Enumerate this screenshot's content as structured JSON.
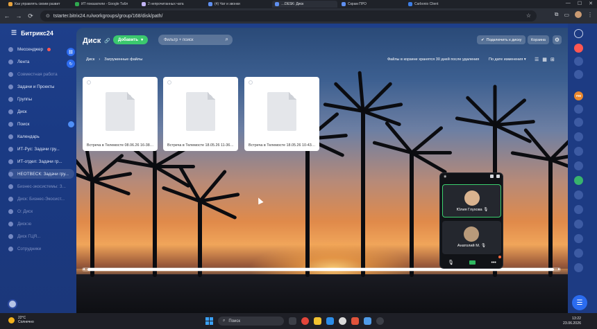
{
  "browser": {
    "tabs": [
      {
        "label": "Как управлять своим развит",
        "color": "#e8a33d"
      },
      {
        "label": "ИТ показатели - Google Табл",
        "color": "#2fa84f"
      },
      {
        "label": "2 непрочитанных чата",
        "color": "#c3b5f7"
      },
      {
        "label": "(4) Чат и звонки",
        "color": "#5f8ff0"
      },
      {
        "label": "…DESK: Диск",
        "color": "#5f8ff0",
        "active": true
      },
      {
        "label": "Скрам ПРО",
        "color": "#5f8ff0"
      },
      {
        "label": "Carbonio Client",
        "color": "#3d7ee6"
      }
    ],
    "url": "tstarter.bitrix24.ru/workgroups/group/168/disk/path/"
  },
  "leftmenu": {
    "brand": "Битрикс24",
    "items": [
      {
        "label": "Мессенджер",
        "state": "normal",
        "badge": "red"
      },
      {
        "label": "Лента",
        "state": "normal"
      },
      {
        "label": "Совместная работа",
        "state": "dim"
      },
      {
        "label": "Задачи и Проекты",
        "state": "normal"
      },
      {
        "label": "Группы",
        "state": "normal"
      },
      {
        "label": "Диск",
        "state": "normal"
      },
      {
        "label": "Поиск",
        "state": "normal",
        "badge": "blue"
      },
      {
        "label": "Календарь",
        "state": "normal"
      },
      {
        "label": "ИТ-Рус: Задачи гру...",
        "state": "normal"
      },
      {
        "label": "ИТ-отдел: Задачи гр...",
        "state": "normal"
      },
      {
        "label": "НЕОТВЕСК: Задачи гру...",
        "state": "active"
      },
      {
        "label": "Бизнес-экосистемы: З...",
        "state": "dim"
      },
      {
        "label": "Диск: Бизнес-Экосист...",
        "state": "dim"
      },
      {
        "label": "О: Диск",
        "state": "dim"
      },
      {
        "label": "Диск:ю",
        "state": "dim"
      },
      {
        "label": "Диск ГЦЯ...",
        "state": "dim"
      },
      {
        "label": "Сотрудники",
        "state": "dim"
      }
    ]
  },
  "disk": {
    "title": "Диск",
    "add_label": "Добавить",
    "filter_placeholder": "Фильтр + поиск",
    "connect_label": "Подключить к диску",
    "trash_label": "Корзина",
    "breadcrumb_root": "Диск",
    "breadcrumb_current": "Загруженные файлы",
    "keep_note": "Файлы в корзине хранятся 30 дней после удаления",
    "sort_label": "По дате изменения",
    "files": [
      {
        "name": "Встреча в Телемосте 08.06.26 16-38-..."
      },
      {
        "name": "Встреча в Телемосте 18.05.26 11-36-0..."
      },
      {
        "name": "Встреча в Телемосте 18.05.26 10-43-..."
      }
    ]
  },
  "call": {
    "participants": [
      {
        "name": "Юлия Глухова",
        "speaking": true,
        "face": "#d9b38f"
      },
      {
        "name": "Анатолий М.",
        "speaking": false,
        "face": "#b89a7a"
      }
    ]
  },
  "taskbar": {
    "temperature": "22°C",
    "weather": "Солнечно",
    "search": "Поиск",
    "time": "13:22",
    "date": "23.06.2026"
  },
  "colors": {
    "accent_green": "#3bc86e",
    "bitrix_blue": "#1e3f8a",
    "rail_badge": "#e9872d"
  }
}
